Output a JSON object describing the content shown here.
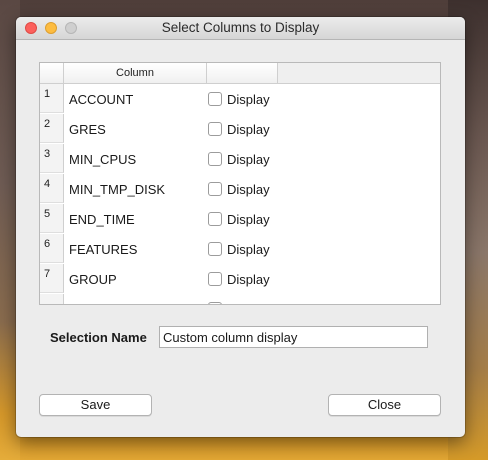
{
  "window": {
    "title": "Select Columns to Display"
  },
  "table": {
    "headers": [
      "",
      "Column",
      ""
    ],
    "rows": [
      {
        "num": "1",
        "name": "ACCOUNT",
        "checkbox_label": "Display",
        "checked": false
      },
      {
        "num": "2",
        "name": "GRES",
        "checkbox_label": "Display",
        "checked": false
      },
      {
        "num": "3",
        "name": "MIN_CPUS",
        "checkbox_label": "Display",
        "checked": false
      },
      {
        "num": "4",
        "name": "MIN_TMP_DISK",
        "checkbox_label": "Display",
        "checked": false
      },
      {
        "num": "5",
        "name": "END_TIME",
        "checkbox_label": "Display",
        "checked": false
      },
      {
        "num": "6",
        "name": "FEATURES",
        "checkbox_label": "Display",
        "checked": false
      },
      {
        "num": "7",
        "name": "GROUP",
        "checkbox_label": "Display",
        "checked": false
      }
    ]
  },
  "selection": {
    "label": "Selection Name",
    "value": "Custom column display"
  },
  "buttons": {
    "save": "Save",
    "close": "Close"
  }
}
